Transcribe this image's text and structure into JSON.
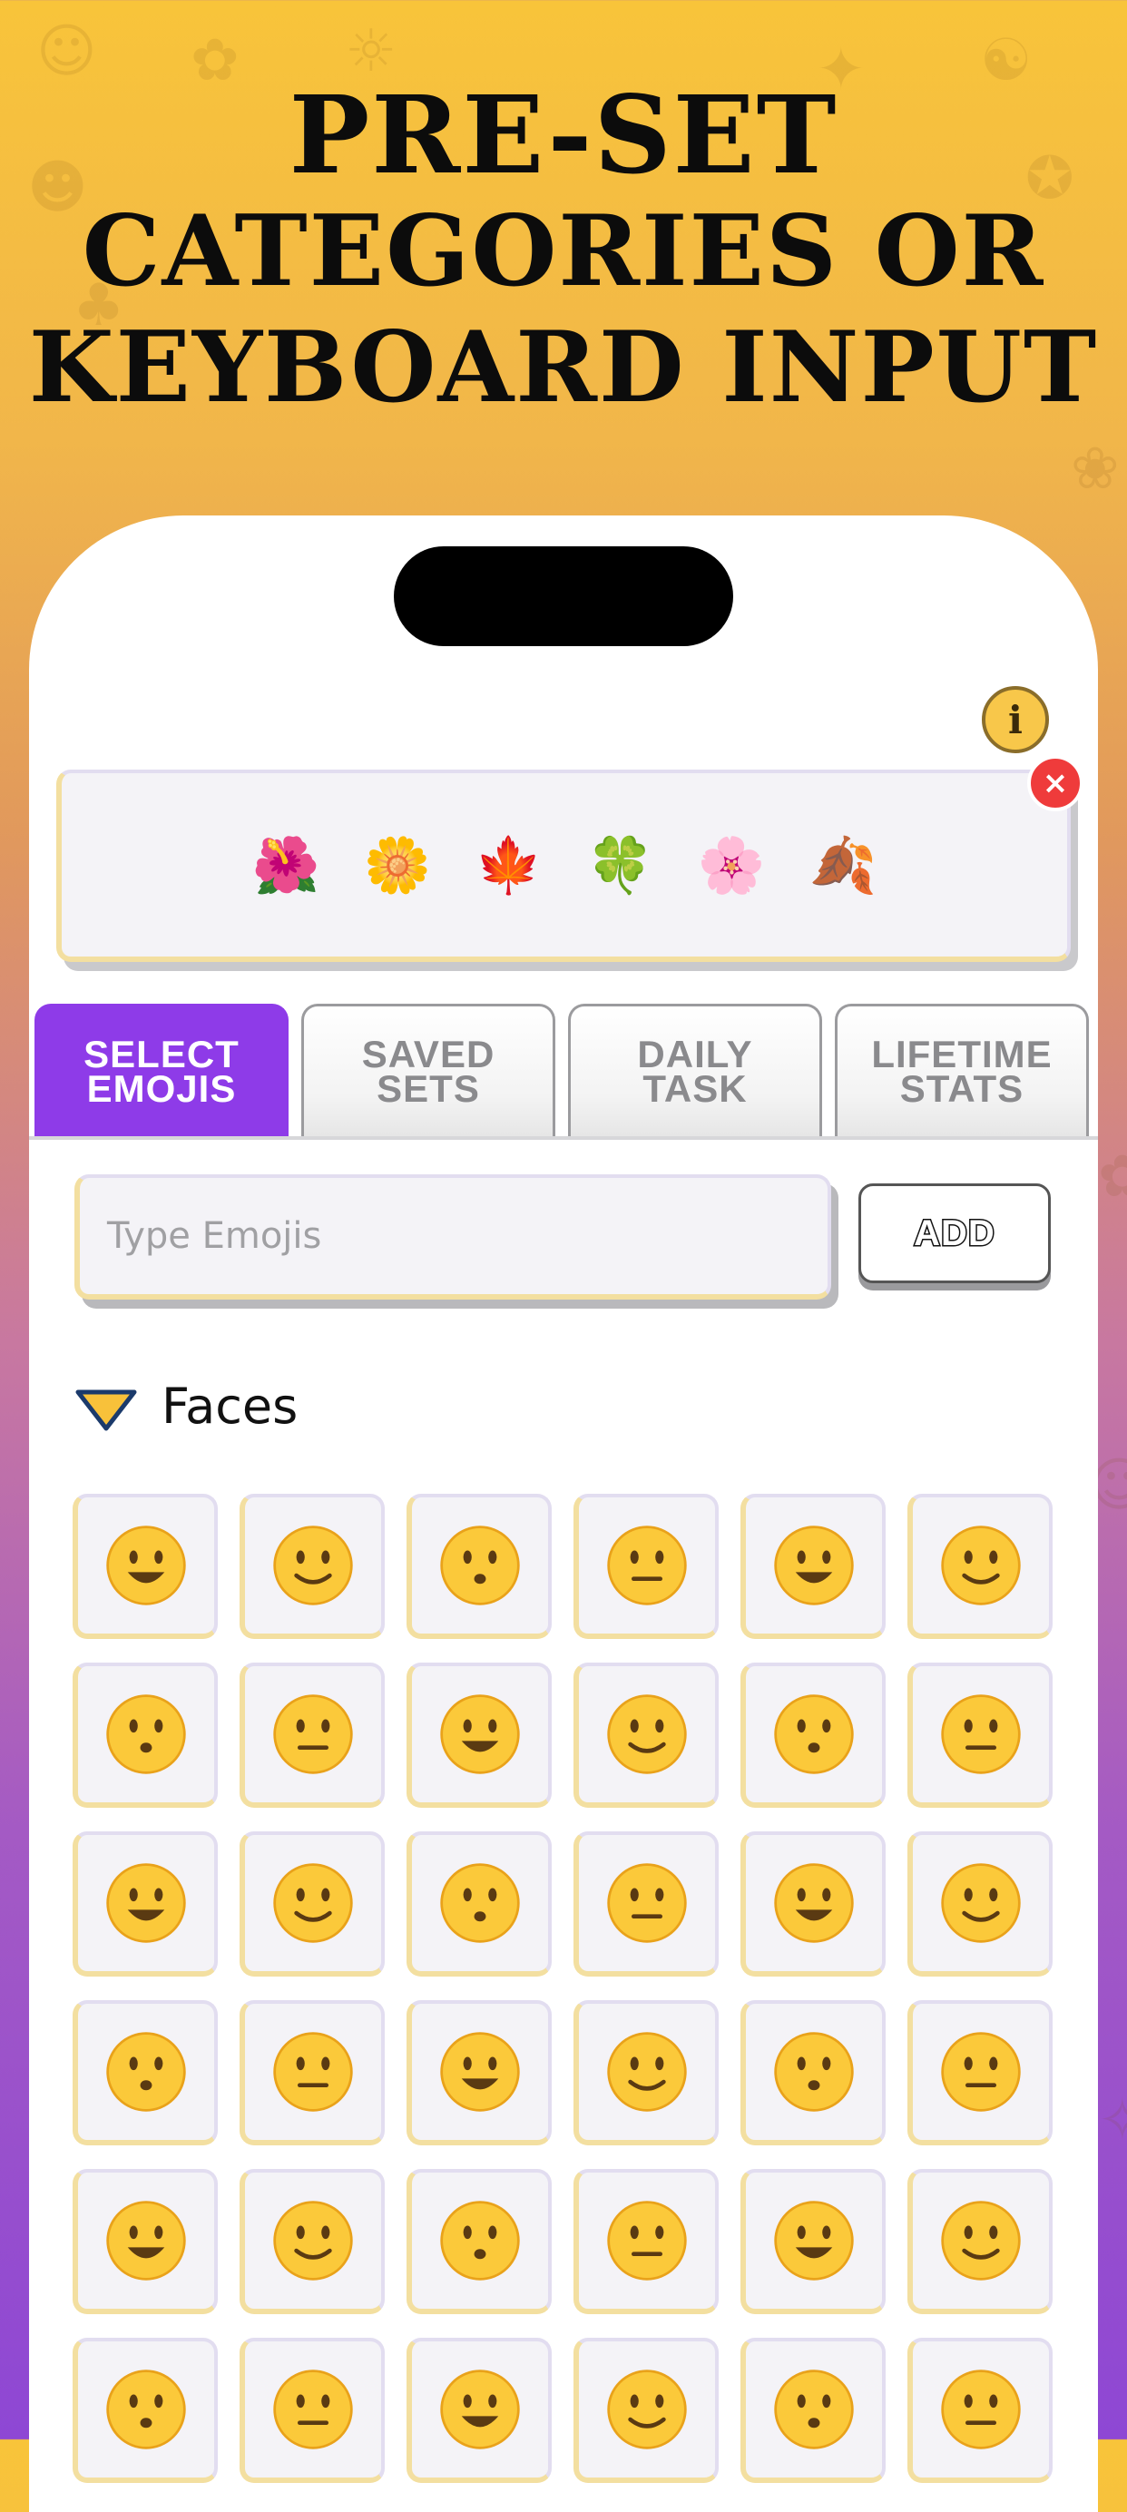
{
  "headline": {
    "line1": "PRE-SET",
    "line2": "CATEGORIES OR",
    "line3": "KEYBOARD INPUT"
  },
  "info_button": {
    "label": "i"
  },
  "selected_emojis": [
    "🌺",
    "🌼",
    "🍁",
    "🍀",
    "🌸",
    "🍂"
  ],
  "clear_button": {
    "label": "×"
  },
  "tabs": [
    {
      "label": "SELECT\nEMOJIS",
      "active": true
    },
    {
      "label": "SAVED\nSETS",
      "active": false
    },
    {
      "label": "DAILY\nTASK",
      "active": false
    },
    {
      "label": "LIFETIME\nSTATS",
      "active": false
    }
  ],
  "input": {
    "placeholder": "Type Emojis",
    "value": ""
  },
  "add_button": {
    "label": "ADD"
  },
  "category": {
    "title": "Faces",
    "icon": "triangle-down-icon"
  },
  "emoji_grid": [
    "😀",
    "😃",
    "😄",
    "😁",
    "😆",
    "😅",
    "🤣",
    "😂",
    "🙂",
    "🙃",
    "😉",
    "😊",
    "😇",
    "🥰",
    "😍",
    "🤩",
    "😘",
    "😗",
    "☺️",
    "😚",
    "😙",
    "🥲",
    "😋",
    "😛",
    "😜",
    "🤪",
    "😝",
    "🤑",
    "🤗",
    "🤭",
    "🤫",
    "🤔",
    "🤐",
    "🤨",
    "😐",
    "😑"
  ],
  "colors": {
    "accent": "#8e3be8",
    "face_yellow": "#fbc93a",
    "clear_red": "#ef3b3b"
  }
}
